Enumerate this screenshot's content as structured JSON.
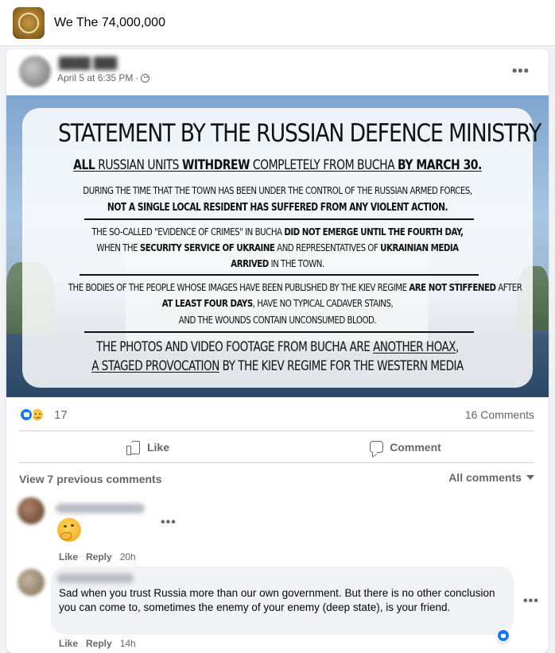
{
  "group": {
    "name": "We The 74,000,000"
  },
  "post": {
    "timestamp": "April 5 at 6:35 PM",
    "separator": "·",
    "more": "•••",
    "image_text": {
      "title": "STATEMENT BY THE RUSSIAN DEFENCE MINISTRY",
      "l1_a": "ALL",
      "l1_b": " RUSSIAN UNITS ",
      "l1_c": "WITHDREW",
      "l1_d": " COMPLETELY FROM BUCHA ",
      "l1_e": "BY MARCH 30.",
      "l2": "DURING THE TIME THAT THE TOWN HAS BEEN UNDER THE CONTROL OF THE RUSSIAN ARMED FORCES,",
      "l3": "NOT A SINGLE LOCAL RESIDENT HAS SUFFERED FROM ANY VIOLENT ACTION.",
      "l4_a": "THE SO-CALLED \"EVIDENCE OF CRIMES\" IN BUCHA ",
      "l4_b": "DID NOT EMERGE UNTIL THE FOURTH DAY,",
      "l5_a": "WHEN THE ",
      "l5_b": "SECURITY SERVICE OF UKRAINE",
      "l5_c": " AND REPRESENTATIVES OF ",
      "l5_d": "UKRAINIAN MEDIA",
      "l6_a": "ARRIVED",
      "l6_b": " IN THE TOWN.",
      "l7_a": "THE BODIES OF THE PEOPLE WHOSE IMAGES HAVE BEEN PUBLISHED BY THE KIEV REGIME ",
      "l7_b": "ARE NOT STIFFENED",
      "l7_c": " AFTER",
      "l8_a": "AT LEAST FOUR DAYS",
      "l8_b": ", HAVE NO TYPICAL CADAVER STAINS,",
      "l9": "AND THE WOUNDS CONTAIN UNCONSUMED BLOOD.",
      "l10_a": "THE PHOTOS AND VIDEO FOOTAGE FROM BUCHA ARE ",
      "l10_b": "ANOTHER HOAX",
      "l10_c": ",",
      "l11_a": "A STAGED PROVOCATION",
      "l11_b": " BY THE KIEV REGIME FOR THE WESTERN MEDIA"
    },
    "reaction_count": "17",
    "comments_count": "16 Comments",
    "actions": {
      "like": "Like",
      "comment": "Comment"
    }
  },
  "comments_section": {
    "view_previous": "View 7 previous comments",
    "filter": "All comments",
    "comments": [
      {
        "emoji": "thinking-face",
        "like": "Like",
        "reply": "Reply",
        "time": "20h",
        "more": "•••"
      },
      {
        "text": "Sad when you trust Russia more than our own government. But there is no other conclusion you can come to, sometimes the enemy of your enemy (deep state), is your friend.",
        "like": "Like",
        "reply": "Reply",
        "time": "14h",
        "more": "•••"
      }
    ]
  },
  "colors": {
    "accent": "#1877f2",
    "muted": "#65676b",
    "page_bg": "#f0f2f5"
  }
}
